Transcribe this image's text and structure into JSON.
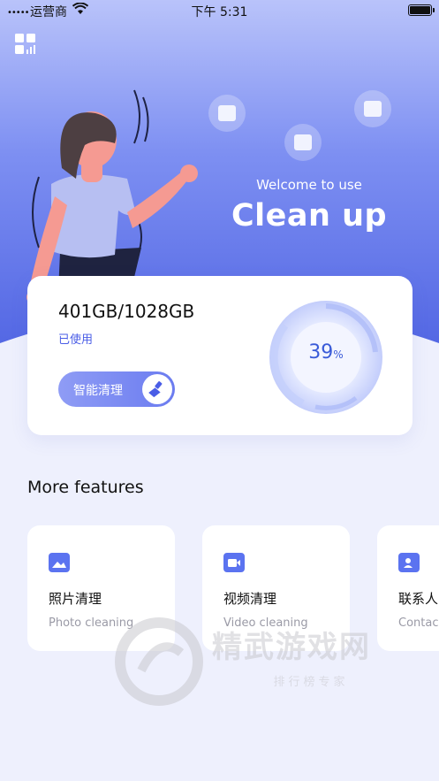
{
  "status_bar": {
    "signal": "•••••",
    "carrier": "运营商",
    "wifi_icon": "wifi-icon",
    "time": "下午 5:31",
    "battery_icon": "battery-full-icon"
  },
  "header": {
    "menu_icon": "grid-menu-icon",
    "welcome": "Welcome to use",
    "title": "Clean up"
  },
  "storage": {
    "value": "401GB/1028GB",
    "used_label": "已使用",
    "clean_button": "智能清理",
    "clean_button_icon": "brush-icon",
    "percent": "39",
    "percent_unit": "%"
  },
  "features": {
    "title": "More features",
    "items": [
      {
        "title": "照片清理",
        "subtitle": "Photo cleaning",
        "icon": "photo-icon"
      },
      {
        "title": "视频清理",
        "subtitle": "Video cleaning",
        "icon": "video-icon"
      },
      {
        "title": "联系人",
        "subtitle": "Contac",
        "icon": "contact-icon"
      }
    ]
  },
  "watermark": {
    "brand": "精武游戏网",
    "tagline": "排行榜专家"
  },
  "colors": {
    "accent": "#4a5de6",
    "hero_top": "#8ea0f5",
    "hero_bottom": "#5a6fe6",
    "background": "#eef0fd"
  }
}
